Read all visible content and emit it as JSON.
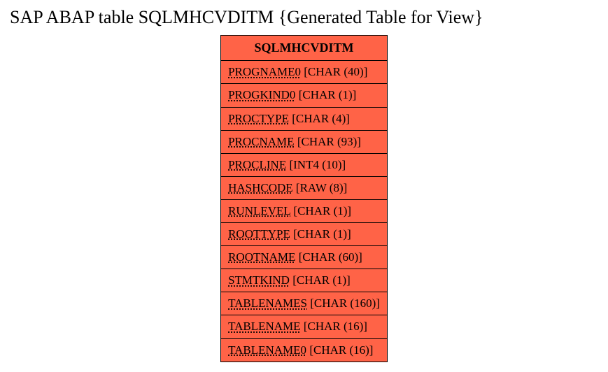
{
  "title": "SAP ABAP table SQLMHCVDITM {Generated Table for View}",
  "table": {
    "header": "SQLMHCVDITM",
    "rows": [
      {
        "field": "PROGNAME0",
        "type": " [CHAR (40)]"
      },
      {
        "field": "PROGKIND0",
        "type": " [CHAR (1)]"
      },
      {
        "field": "PROCTYPE",
        "type": " [CHAR (4)]"
      },
      {
        "field": "PROCNAME",
        "type": " [CHAR (93)]"
      },
      {
        "field": "PROCLINE",
        "type": " [INT4 (10)]"
      },
      {
        "field": "HASHCODE",
        "type": " [RAW (8)]"
      },
      {
        "field": "RUNLEVEL",
        "type": " [CHAR (1)]"
      },
      {
        "field": "ROOTTYPE",
        "type": " [CHAR (1)]"
      },
      {
        "field": "ROOTNAME",
        "type": " [CHAR (60)]"
      },
      {
        "field": "STMTKIND",
        "type": " [CHAR (1)]"
      },
      {
        "field": "TABLENAMES",
        "type": " [CHAR (160)]"
      },
      {
        "field": "TABLENAME",
        "type": " [CHAR (16)]"
      },
      {
        "field": "TABLENAME0",
        "type": " [CHAR (16)]"
      }
    ]
  }
}
